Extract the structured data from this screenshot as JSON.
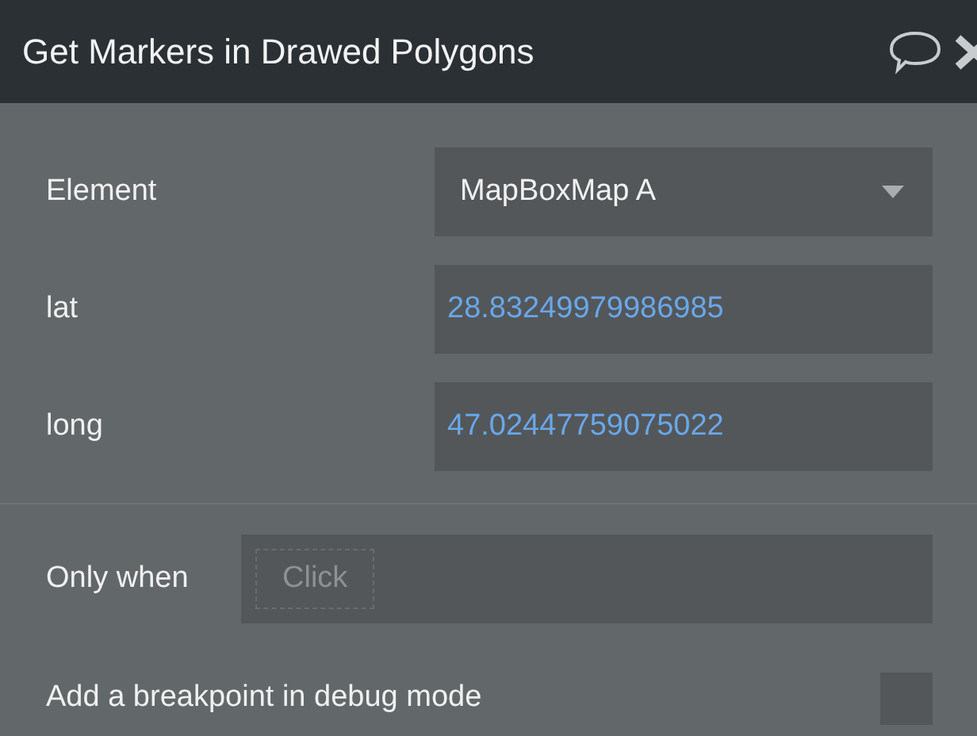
{
  "window": {
    "title": "Get Markers in Drawed Polygons"
  },
  "fields": [
    {
      "label": "Element",
      "kind": "dropdown",
      "value": "MapBoxMap A"
    },
    {
      "label": "lat",
      "kind": "text",
      "value": "28.83249979986985"
    },
    {
      "label": "long",
      "kind": "text",
      "value": "47.02447759075022"
    }
  ],
  "condition": {
    "label": "Only when",
    "placeholder": "Click"
  },
  "breakpoint": {
    "label": "Add a breakpoint in debug mode",
    "checked": false
  }
}
